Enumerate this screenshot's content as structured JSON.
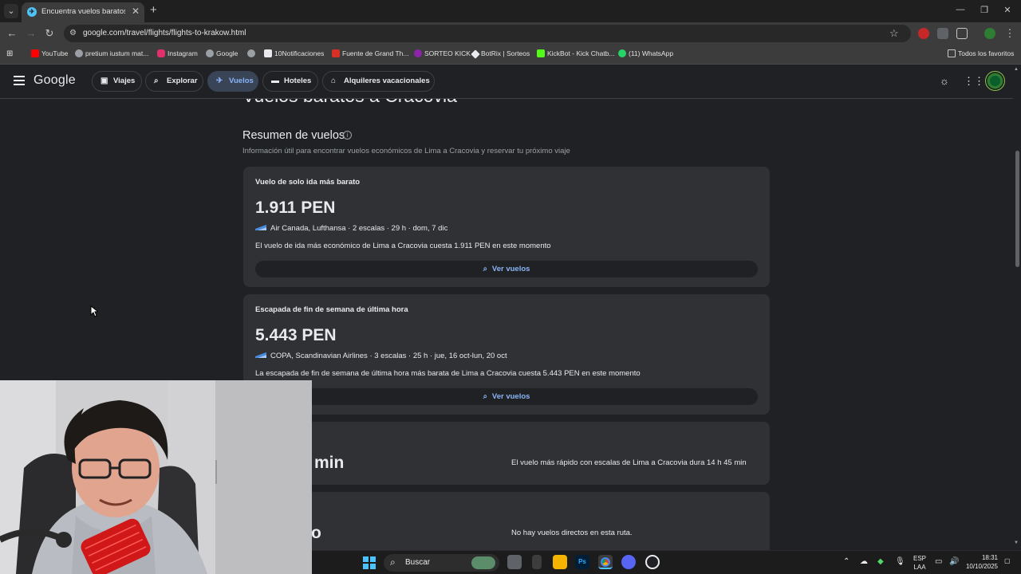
{
  "browser": {
    "tab_title": "Encuentra vuelos baratos a Cra",
    "url": "google.com/travel/flights/flights-to-krakow.html",
    "bookmarks": [
      {
        "label": "YouTube",
        "color": "#ff0000"
      },
      {
        "label": "pretium iustum mat...",
        "color": "#9aa0a6"
      },
      {
        "label": "Instagram",
        "color": "#e1306c"
      },
      {
        "label": "Google",
        "color": "#9aa0a6"
      },
      {
        "label": "",
        "color": "#9aa0a6"
      },
      {
        "label": "10Notificaciones",
        "color": "#e8eaed"
      },
      {
        "label": "Fuente de Grand Th...",
        "color": "#d93025"
      },
      {
        "label": "SORTEO KICK",
        "color": "#8e24aa"
      },
      {
        "label": "BotRix | Sorteos",
        "color": "#e8eaed"
      },
      {
        "label": "KickBot - Kick Chatb...",
        "color": "#53fc18"
      },
      {
        "label": "(11) WhatsApp",
        "color": "#25d366"
      }
    ],
    "all_bookmarks_label": "Todos los favoritos"
  },
  "header": {
    "logo": "Google",
    "chips": [
      {
        "label": "Viajes",
        "icon": "suitcase-icon"
      },
      {
        "label": "Explorar",
        "icon": "explore-icon"
      },
      {
        "label": "Vuelos",
        "icon": "plane-icon",
        "active": true
      },
      {
        "label": "Hoteles",
        "icon": "bed-icon"
      },
      {
        "label": "Alquileres vacacionales",
        "icon": "house-icon"
      }
    ]
  },
  "main": {
    "page_title": "Vuelos baratos a Cracovia",
    "summary_heading": "Resumen de vuelos",
    "summary_subtitle": "Información útil para encontrar vuelos económicos de Lima a Cracovia y reservar tu próximo viaje",
    "cards": [
      {
        "label": "Vuelo de solo ida más barato",
        "price": "1.911 PEN",
        "meta": "Air Canada, Lufthansa · 2 escalas · 29 h · dom, 7 dic",
        "description": "El vuelo de ida más económico de Lima a Cracovia cuesta 1.911 PEN en este momento",
        "button": "Ver vuelos"
      },
      {
        "label": "Escapada de fin de semana de última hora",
        "price": "5.443 PEN",
        "meta": "COPA, Scandinavian Airlines · 3 escalas · 25 h · jue, 16 oct-lun, 20 oct",
        "description": "La escapada de fin de semana de última hora más barata de Lima a Cracovia cuesta 5.443 PEN en este momento",
        "button": "Ver vuelos"
      },
      {
        "big_partial": "min",
        "right_text": "El vuelo más rápido con escalas de Lima a Cracovia dura 14 h 45 min"
      },
      {
        "big_partial": "o",
        "right_text": "No hay vuelos directos en esta ruta."
      }
    ]
  },
  "taskbar": {
    "search_label": "Buscar",
    "lang_top": "ESP",
    "lang_bottom": "LAA",
    "time": "18:31",
    "date": "10/10/2025"
  }
}
